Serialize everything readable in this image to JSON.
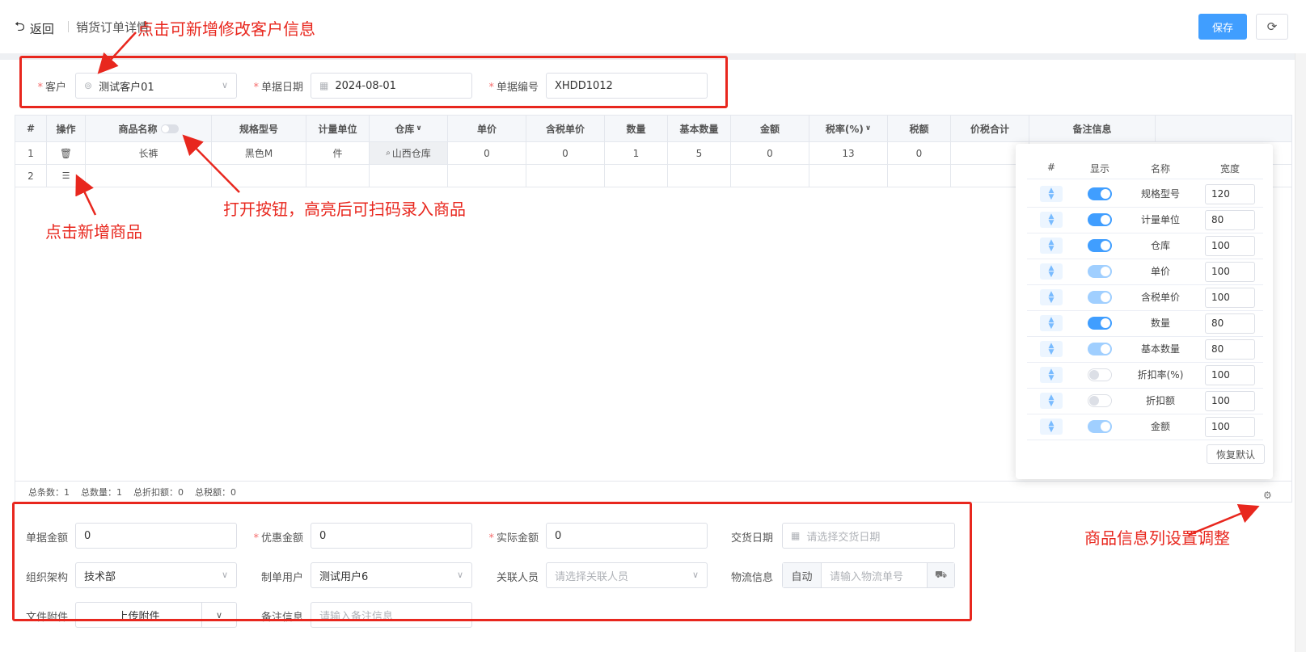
{
  "header": {
    "back_label": "返回",
    "breadcrumb": "销货订单详情",
    "save_label": "保存"
  },
  "top_form": {
    "customer_label": "客户",
    "customer_value": "测试客户01",
    "date_label": "单据日期",
    "date_value": "2024-08-01",
    "number_label": "单据编号",
    "number_value": "XHDD1012"
  },
  "table": {
    "columns": [
      "#",
      "操作",
      "商品名称",
      "规格型号",
      "计量单位",
      "仓库",
      "单价",
      "含税单价",
      "数量",
      "基本数量",
      "金额",
      "税率(%)",
      "税额",
      "价税合计",
      "备注信息"
    ],
    "rows": [
      {
        "index": "1",
        "name": "长裤",
        "spec": "黑色M",
        "unit": "件",
        "warehouse": "山西仓库",
        "price": "0",
        "tax_price": "0",
        "qty": "1",
        "base_qty": "5",
        "amount": "0",
        "tax_rate": "13",
        "tax": "0"
      },
      {
        "index": "2"
      }
    ],
    "summary": {
      "count": "总条数：1",
      "qty": "总数量：1",
      "discount": "总折扣额：0",
      "tax": "总税额：0"
    }
  },
  "column_settings": {
    "headers": [
      "#",
      "显示",
      "名称",
      "宽度"
    ],
    "rows": [
      {
        "name": "规格型号",
        "width": "120",
        "state": "on"
      },
      {
        "name": "计量单位",
        "width": "80",
        "state": "on"
      },
      {
        "name": "仓库",
        "width": "100",
        "state": "on"
      },
      {
        "name": "单价",
        "width": "100",
        "state": "half"
      },
      {
        "name": "含税单价",
        "width": "100",
        "state": "half"
      },
      {
        "name": "数量",
        "width": "80",
        "state": "on"
      },
      {
        "name": "基本数量",
        "width": "80",
        "state": "half"
      },
      {
        "name": "折扣率(%)",
        "width": "100",
        "state": "off"
      },
      {
        "name": "折扣额",
        "width": "100",
        "state": "off"
      },
      {
        "name": "金额",
        "width": "100",
        "state": "half"
      }
    ],
    "restore_label": "恢复默认"
  },
  "bottom_form": {
    "doc_amount_label": "单据金额",
    "doc_amount_value": "0",
    "discount_label": "优惠金额",
    "discount_value": "0",
    "actual_label": "实际金额",
    "actual_value": "0",
    "delivery_label": "交货日期",
    "delivery_placeholder": "请选择交货日期",
    "org_label": "组织架构",
    "org_value": "技术部",
    "creator_label": "制单用户",
    "creator_value": "测试用户6",
    "related_label": "关联人员",
    "related_placeholder": "请选择关联人员",
    "logistics_label": "物流信息",
    "logistics_auto": "自动",
    "logistics_placeholder": "请输入物流单号",
    "attach_label": "文件附件",
    "attach_button": "上传附件",
    "remark_label": "备注信息",
    "remark_placeholder": "请输入备注信息"
  },
  "annotations": {
    "customer_note": "点击可新增修改客户信息",
    "scan_note": "打开按钮，高亮后可扫码录入商品",
    "add_note": "点击新增商品",
    "column_note": "商品信息列设置调整"
  },
  "colors": {
    "accent": "#409eff",
    "annotation": "#e8271e"
  }
}
